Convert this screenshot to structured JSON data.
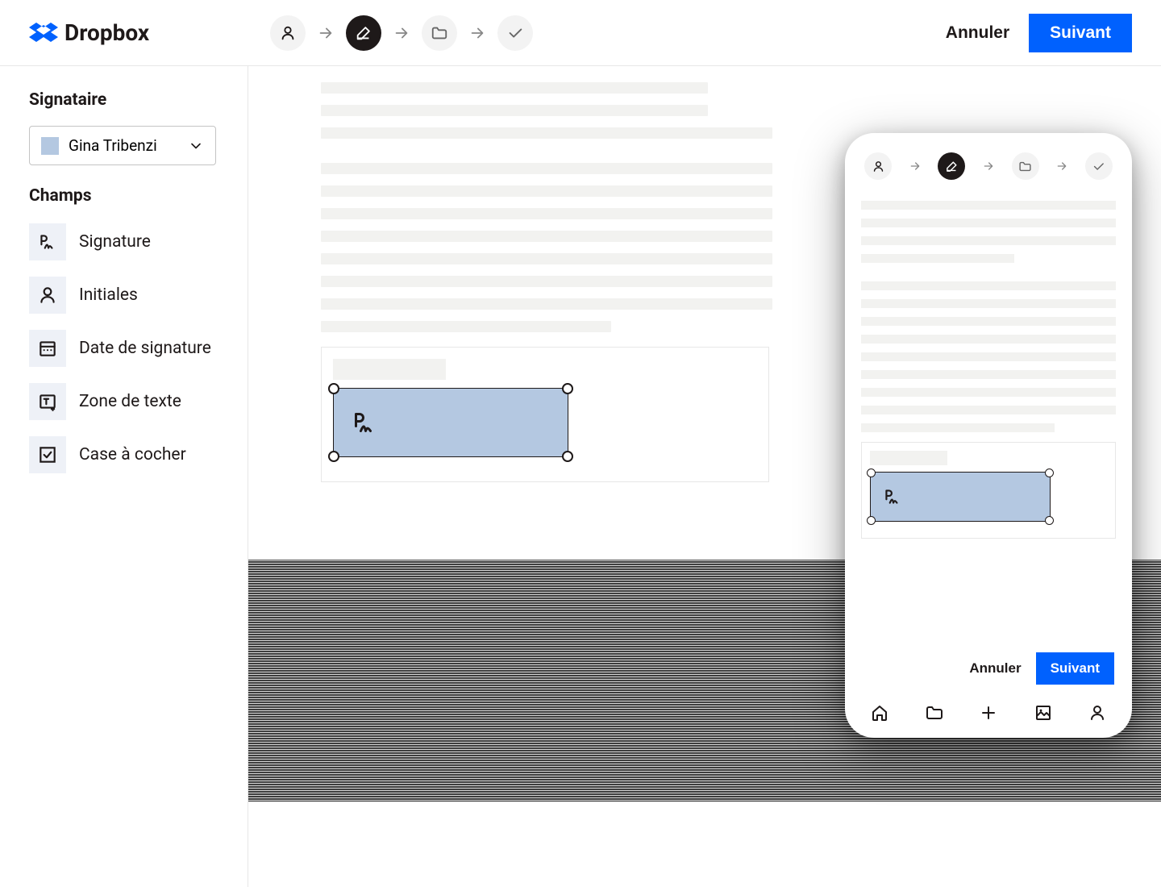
{
  "logo_text": "Dropbox",
  "header": {
    "cancel": "Annuler",
    "next": "Suivant"
  },
  "sidebar": {
    "signer_title": "Signataire",
    "signer_name": "Gina Tribenzi",
    "fields_title": "Champs",
    "fields": [
      {
        "label": "Signature"
      },
      {
        "label": "Initiales"
      },
      {
        "label": "Date de signature"
      },
      {
        "label": "Zone de texte"
      },
      {
        "label": "Case à cocher"
      }
    ]
  },
  "mobile": {
    "cancel": "Annuler",
    "next": "Suivant"
  }
}
